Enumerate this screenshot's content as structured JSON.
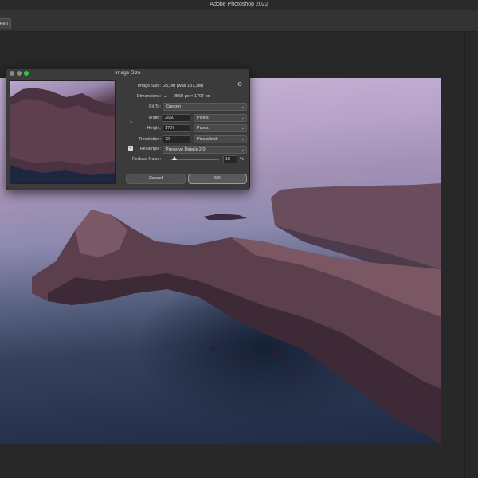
{
  "app": {
    "window_title": "Adobe Photoshop 2022",
    "option_button": "een"
  },
  "dialog": {
    "title": "Image Size",
    "image_size_label": "Image Size:",
    "image_size_value": "25,0M (was 137,3M)",
    "dimensions_label": "Dimensions:",
    "dimensions_value": "2560 px  ×  1707 px",
    "fit_to_label": "Fit To:",
    "fit_to_value": "Custom",
    "width_label": "Width:",
    "width_value": "2560",
    "width_unit": "Pixels",
    "height_label": "Height:",
    "height_value": "1707",
    "height_unit": "Pixels",
    "resolution_label": "Resolution:",
    "resolution_value": "72",
    "resolution_unit": "Pixels/Inch",
    "resample_label": "Resample:",
    "resample_checked": true,
    "resample_value": "Preserve Details 2.0",
    "reduce_noise_label": "Reduce Noise:",
    "reduce_noise_value": "10",
    "reduce_noise_unit": "%",
    "reduce_noise_fraction": 0.1,
    "cancel_label": "Cancel",
    "ok_label": "OK"
  },
  "icons": {
    "gear": "gear-icon",
    "link": "chain-link-icon",
    "chevron": "chevron-down-icon",
    "check": "checkmark-icon"
  },
  "colors": {
    "traffic_light_green": "#2bc840",
    "dialog_bg": "#3b3b3b",
    "workspace_bg": "#282828"
  }
}
